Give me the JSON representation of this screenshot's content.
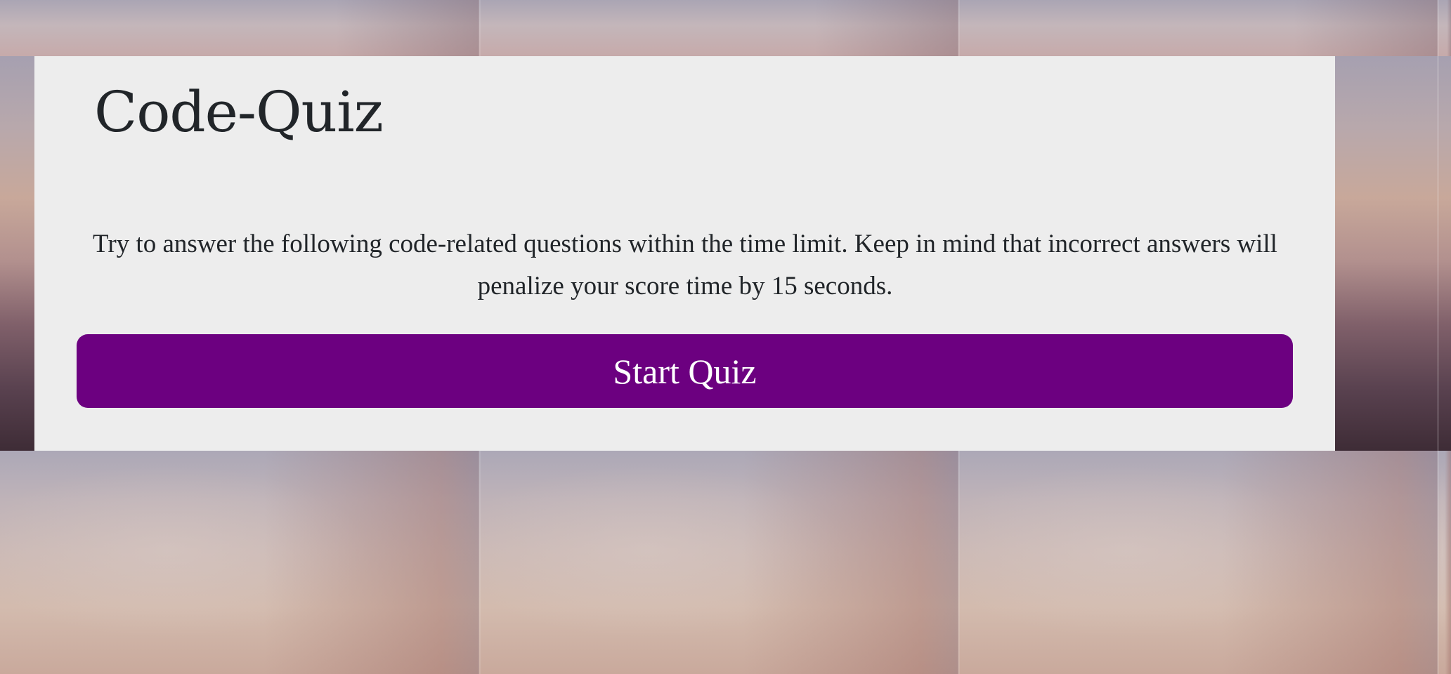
{
  "page": {
    "title": "Code-Quiz",
    "description": "Try to answer the following code-related questions within the time limit. Keep in mind that incorrect answers will penalize your score time by 15 seconds.",
    "start_button_label": "Start Quiz"
  },
  "colors": {
    "card_background": "#ededed",
    "text": "#212529",
    "button_background": "#6c0080",
    "button_text": "#ffffff"
  }
}
